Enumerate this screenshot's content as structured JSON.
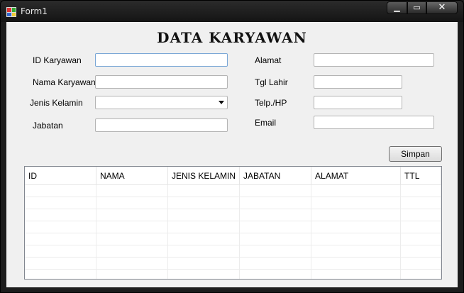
{
  "window": {
    "title": "Form1",
    "min_glyph": "▁",
    "max_glyph": "▭",
    "close_glyph": "✕"
  },
  "form": {
    "heading": "DATA KARYAWAN",
    "fields": {
      "id_label": "ID Karyawan",
      "nama_label": "Nama Karyawan",
      "jenis_label": "Jenis Kelamin",
      "jabatan_label": "Jabatan",
      "alamat_label": "Alamat",
      "tgl_label": "Tgl Lahir",
      "telp_label": "Telp./HP",
      "email_label": "Email"
    },
    "save_label": "Simpan"
  },
  "grid": {
    "columns": [
      "ID",
      "NAMA",
      "JENIS KELAMIN",
      "JABATAN",
      "ALAMAT",
      "TTL"
    ],
    "empty_rows": 8
  }
}
